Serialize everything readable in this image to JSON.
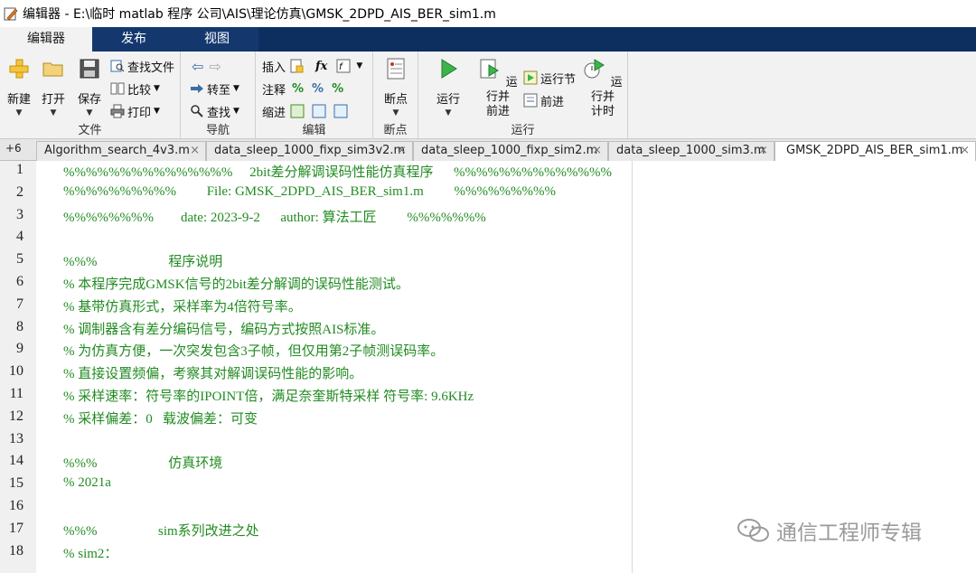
{
  "window": {
    "title": "编辑器 - E:\\临时 matlab 程序 公司\\AIS\\理论仿真\\GMSK_2DPD_AIS_BER_sim1.m"
  },
  "ribbon_tabs": [
    {
      "label": "编辑器",
      "active": true
    },
    {
      "label": "发布",
      "active": false
    },
    {
      "label": "视图",
      "active": false
    }
  ],
  "ribbon": {
    "file": {
      "group_label": "文件",
      "new": "新建",
      "open": "打开",
      "save": "保存",
      "find_files": "查找文件",
      "compare": "比较",
      "print": "打印"
    },
    "navigate": {
      "group_label": "导航",
      "goto": "转至",
      "find": "查找"
    },
    "edit": {
      "group_label": "编辑",
      "insert": "插入",
      "comment": "注释",
      "indent": "缩进",
      "fx": "fx"
    },
    "breakpoints": {
      "group_label": "断点",
      "breakpoints": "断点"
    },
    "run": {
      "group_label": "运行",
      "run": "运行",
      "run_advance": "运行并\n前进",
      "run_section": "运行节",
      "advance": "前进",
      "run_time": "运行并\n计时"
    }
  },
  "doc_tabs": {
    "overflow_label": "+6",
    "tabs": [
      {
        "label": "Algorithm_search_4v3.m",
        "active": false
      },
      {
        "label": "data_sleep_1000_fixp_sim3v2.m",
        "active": false
      },
      {
        "label": "data_sleep_1000_fixp_sim2.m",
        "active": false
      },
      {
        "label": "data_sleep_1000_sim3.m",
        "active": false
      },
      {
        "label": "GMSK_2DPD_AIS_BER_sim1.m",
        "active": true
      }
    ],
    "close_glyph": "×"
  },
  "code_lines": [
    {
      "num": "1",
      "text": "%%%%%%%%%%%%%%%     2bit差分解调误码性能仿真程序      %%%%%%%%%%%%%%"
    },
    {
      "num": "2",
      "text": "%%%%%%%%%%         File: GMSK_2DPD_AIS_BER_sim1.m         %%%%%%%%%"
    },
    {
      "num": "3",
      "text": "%%%%%%%%        date: 2023-9-2      author: 算法工匠         %%%%%%%"
    },
    {
      "num": "4",
      "text": ""
    },
    {
      "num": "5",
      "text": "%%%                     程序说明"
    },
    {
      "num": "6",
      "text": "% 本程序完成GMSK信号的2bit差分解调的误码性能测试。"
    },
    {
      "num": "7",
      "text": "% 基带仿真形式，采样率为4倍符号率。"
    },
    {
      "num": "8",
      "text": "% 调制器含有差分编码信号，编码方式按照AIS标准。"
    },
    {
      "num": "9",
      "text": "% 为仿真方便，一次突发包含3子帧，但仅用第2子帧测误码率。"
    },
    {
      "num": "10",
      "text": "% 直接设置频偏，考察其对解调误码性能的影响。"
    },
    {
      "num": "11",
      "text": "% 采样速率：符号率的IPOINT倍，满足奈奎斯特采样 符号率: 9.6KHz"
    },
    {
      "num": "12",
      "text": "% 采样偏差：0   载波偏差：可变"
    },
    {
      "num": "13",
      "text": ""
    },
    {
      "num": "14",
      "text": "%%%                     仿真环境"
    },
    {
      "num": "15",
      "text": "% 2021a"
    },
    {
      "num": "16",
      "text": ""
    },
    {
      "num": "17",
      "text": "%%%                  sim系列改进之处"
    },
    {
      "num": "18",
      "text": "% sim2："
    }
  ],
  "watermark": {
    "text": "通信工程师专辑"
  },
  "colors": {
    "tabstrip": "#14386e",
    "comment_green": "#228b22",
    "ribbon_bg": "#f2f2f2",
    "gutter_bg": "#f0f0f0"
  }
}
